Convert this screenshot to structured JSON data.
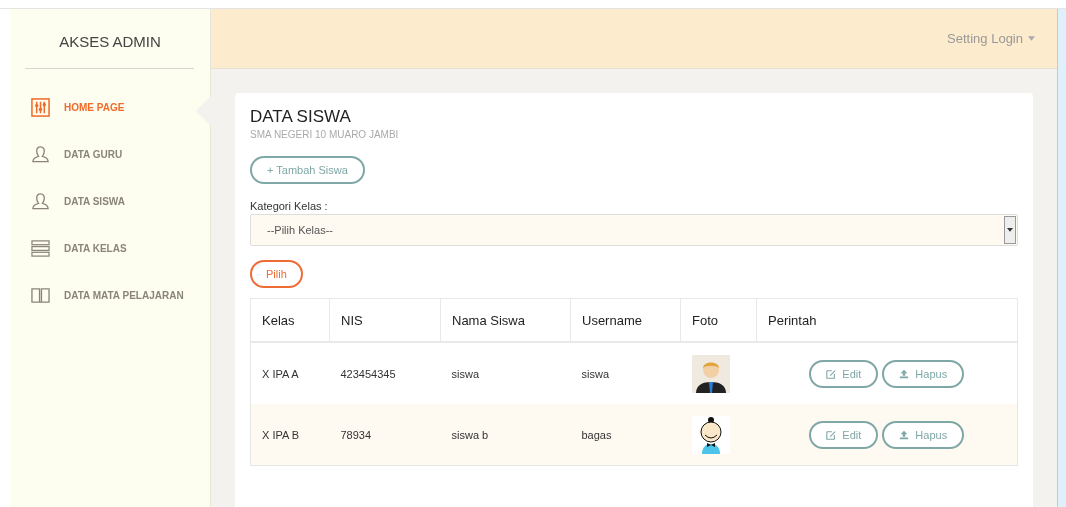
{
  "sidebar": {
    "title": "AKSES ADMIN",
    "items": [
      {
        "label": "HOME PAGE",
        "selected": true
      },
      {
        "label": "DATA GURU",
        "selected": false
      },
      {
        "label": "DATA SISWA",
        "selected": false
      },
      {
        "label": "DATA KELAS",
        "selected": false
      },
      {
        "label": "DATA MATA PELAJARAN",
        "selected": false
      }
    ]
  },
  "header": {
    "menu": "Setting Login"
  },
  "card": {
    "title": "DATA SISWA",
    "subtitle": "SMA NEGERI 10 MUARO JAMBI",
    "add_button": "+ Tambah Siswa",
    "filter_label": "Kategori Kelas :",
    "filter_select": "--Pilih Kelas--",
    "submit_button": "Pilih"
  },
  "table": {
    "columns": [
      "Kelas",
      "NIS",
      "Nama Siswa",
      "Username",
      "Foto",
      "Perintah"
    ],
    "rows": [
      {
        "kelas": "X IPA A",
        "nis": "423454345",
        "nama": "siswa",
        "username": "siswa",
        "actions": [
          "Edit",
          "Hapus"
        ]
      },
      {
        "kelas": "X IPA B",
        "nis": "78934",
        "nama": "siswa b",
        "username": "bagas",
        "actions": [
          "Edit",
          "Hapus"
        ]
      }
    ]
  }
}
